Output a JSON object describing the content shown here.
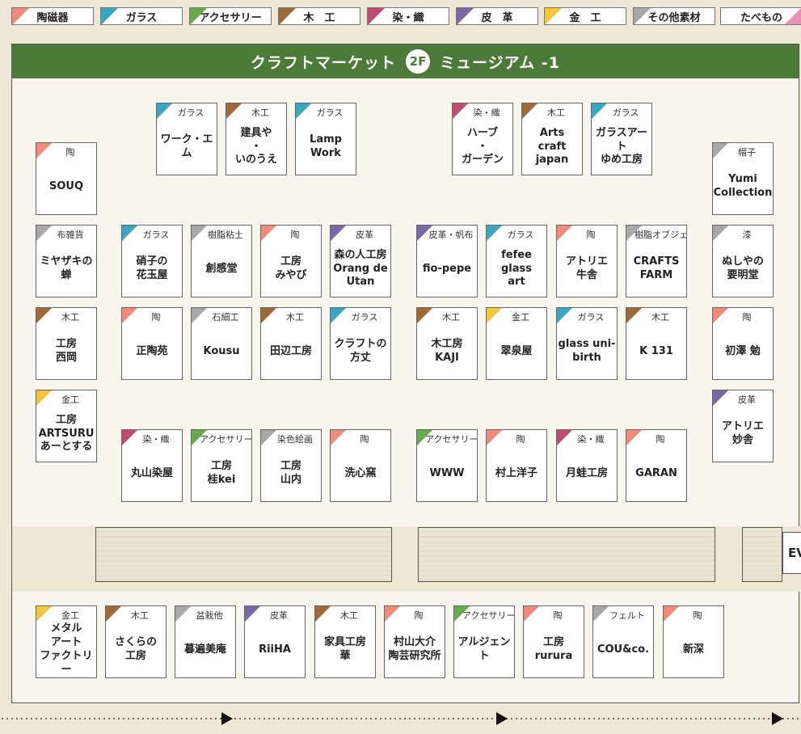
{
  "colors": {
    "ceramics": "#f08a7a",
    "glass": "#3aa6c0",
    "accessory": "#6aaa4e",
    "wood": "#a06a38",
    "textile": "#c04a72",
    "leather": "#7a67a8",
    "metal": "#f3c63a",
    "other": "#a8a8a8",
    "food": "#ea8fb4",
    "header": "#4c7a38"
  },
  "legend": [
    {
      "label": "陶磁器",
      "key": "ceramics"
    },
    {
      "label": "ガラス",
      "key": "glass"
    },
    {
      "label": "アクセサリー",
      "key": "accessory"
    },
    {
      "label": "木　工",
      "key": "wood"
    },
    {
      "label": "染・織",
      "key": "textile"
    },
    {
      "label": "皮　革",
      "key": "leather"
    },
    {
      "label": "金　工",
      "key": "metal"
    },
    {
      "label": "その他素材",
      "key": "other"
    },
    {
      "label": "たべもの",
      "key": "food"
    }
  ],
  "header": {
    "title_left": "クラフトマーケット",
    "floor": "2F",
    "title_right": "ミュージアム -1"
  },
  "booths": [
    {
      "cat": "陶",
      "name": "SOUQ",
      "key": "ceramics"
    },
    {
      "cat": "ガラス",
      "name": "ワーク・エム",
      "key": "glass"
    },
    {
      "cat": "木工",
      "name": "建具や\n・\nいのうえ",
      "key": "wood"
    },
    {
      "cat": "ガラス",
      "name": "Lamp\nWork",
      "key": "glass"
    },
    {
      "cat": "染・織",
      "name": "ハーブ\n・\nガーデン",
      "key": "textile"
    },
    {
      "cat": "木工",
      "name": "Arts\ncraft\njapan",
      "key": "wood"
    },
    {
      "cat": "ガラス",
      "name": "ガラスアート\nゆめ工房",
      "key": "glass"
    },
    {
      "cat": "帽子",
      "name": "Yumi\nCollection",
      "key": "other"
    },
    {
      "cat": "布雑貨",
      "name": "ミヤザキの\n蝉",
      "key": "other"
    },
    {
      "cat": "ガラス",
      "name": "硝子の\n花玉屋",
      "key": "glass"
    },
    {
      "cat": "樹脂粘土",
      "name": "創感堂",
      "key": "other"
    },
    {
      "cat": "陶",
      "name": "工房\nみやび",
      "key": "ceramics"
    },
    {
      "cat": "皮革",
      "name": "森の人工房\nOrang de\nUtan",
      "key": "leather"
    },
    {
      "cat": "皮革・帆布",
      "name": "fio-pepe",
      "key": "leather"
    },
    {
      "cat": "ガラス",
      "name": "fefee\nglass\nart",
      "key": "glass"
    },
    {
      "cat": "陶",
      "name": "アトリエ\n牛舎",
      "key": "ceramics"
    },
    {
      "cat": "樹脂オブジェ",
      "name": "CRAFTS\nFARM",
      "key": "other"
    },
    {
      "cat": "漆",
      "name": "ぬしやの\n要明堂",
      "key": "other"
    },
    {
      "cat": "木工",
      "name": "工房\n西岡",
      "key": "wood"
    },
    {
      "cat": "陶",
      "name": "正陶苑",
      "key": "ceramics"
    },
    {
      "cat": "石細工",
      "name": "Kousu",
      "key": "other"
    },
    {
      "cat": "木工",
      "name": "田辺工房",
      "key": "wood"
    },
    {
      "cat": "ガラス",
      "name": "クラフトの\n方丈",
      "key": "glass"
    },
    {
      "cat": "木工",
      "name": "木工房\nKAJI",
      "key": "wood"
    },
    {
      "cat": "金工",
      "name": "翠泉屋",
      "key": "metal"
    },
    {
      "cat": "ガラス",
      "name": "glass uni-\nbirth",
      "key": "glass"
    },
    {
      "cat": "木工",
      "name": "K 131",
      "key": "wood"
    },
    {
      "cat": "陶",
      "name": "初澤 勉",
      "key": "ceramics"
    },
    {
      "cat": "金工",
      "name": "工房\nARTSURU\nあーとする",
      "key": "metal"
    },
    {
      "cat": "皮革",
      "name": "アトリエ\n妙舎",
      "key": "leather"
    },
    {
      "cat": "染・織",
      "name": "丸山染屋",
      "key": "textile"
    },
    {
      "cat": "アクセサリー",
      "name": "工房\n桂kei",
      "key": "accessory"
    },
    {
      "cat": "染色絵画",
      "name": "工房\n山内",
      "key": "other"
    },
    {
      "cat": "陶",
      "name": "洗心窯",
      "key": "ceramics"
    },
    {
      "cat": "アクセサリー",
      "name": "WWW",
      "key": "accessory"
    },
    {
      "cat": "陶",
      "name": "村上洋子",
      "key": "ceramics"
    },
    {
      "cat": "染・織",
      "name": "月蛙工房",
      "key": "textile"
    },
    {
      "cat": "陶",
      "name": "GARAN",
      "key": "ceramics"
    },
    {
      "cat": "金工",
      "name": "メタル\nアート\nファクトリー",
      "key": "metal"
    },
    {
      "cat": "木工",
      "name": "さくらの\n工房",
      "key": "wood"
    },
    {
      "cat": "盆栽他",
      "name": "暮遍美庵",
      "key": "other"
    },
    {
      "cat": "皮革",
      "name": "RiiHA",
      "key": "leather"
    },
    {
      "cat": "木工",
      "name": "家具工房\n華",
      "key": "wood"
    },
    {
      "cat": "陶",
      "name": "村山大介\n陶芸研究所",
      "key": "ceramics"
    },
    {
      "cat": "アクセサリー",
      "name": "アルジェント",
      "key": "accessory"
    },
    {
      "cat": "陶",
      "name": "工房\nrurura",
      "key": "ceramics"
    },
    {
      "cat": "フェルト",
      "name": "COU&co.",
      "key": "other"
    },
    {
      "cat": "陶",
      "name": "新深",
      "key": "ceramics"
    }
  ],
  "ev_label": "EV"
}
